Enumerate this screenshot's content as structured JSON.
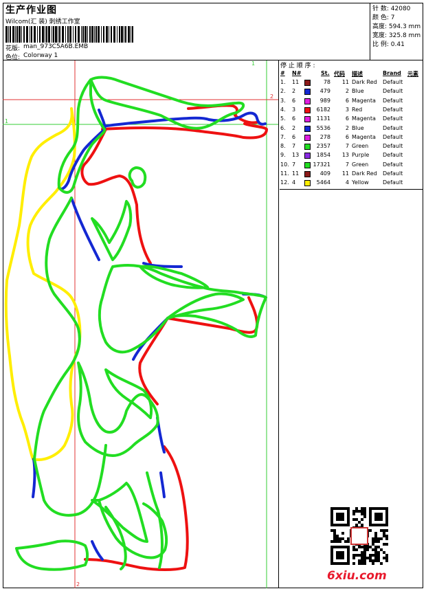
{
  "header": {
    "title": "生产作业图",
    "studio": "Wilcom(汇 装) 刺绣工作室",
    "design_label": "花版:",
    "design_file": "man_973C5A6B.EMB",
    "colorway_label": "色位:",
    "colorway": "Colorway 1"
  },
  "info": {
    "stitches_label": "针 数:",
    "stitches": "42080",
    "colors_label": "颜 色:",
    "colors": "7",
    "height_label": "高度:",
    "height": "594.3 mm",
    "width_label": "宽度:",
    "width": "325.8 mm",
    "scale_label": "比 例:",
    "scale": "0.41"
  },
  "table": {
    "stop_title": "停 止 顺 序 :",
    "headers": {
      "num": "#",
      "no": "N#",
      "st": "St.",
      "code": "代码",
      "desc": "描述",
      "brand": "Brand",
      "elem": "元素"
    },
    "rows": [
      {
        "idx": "1.",
        "n": "11",
        "color": "#8b1a1a",
        "st": "78",
        "code": "11",
        "desc": "Dark Red",
        "brand": "Default"
      },
      {
        "idx": "2.",
        "n": "2",
        "color": "#1428d2",
        "st": "479",
        "code": "2",
        "desc": "Blue",
        "brand": "Default"
      },
      {
        "idx": "3.",
        "n": "6",
        "color": "#e020e0",
        "st": "989",
        "code": "6",
        "desc": "Magenta",
        "brand": "Default"
      },
      {
        "idx": "4.",
        "n": "3",
        "color": "#ee1111",
        "st": "6182",
        "code": "3",
        "desc": "Red",
        "brand": "Default"
      },
      {
        "idx": "5.",
        "n": "6",
        "color": "#e020e0",
        "st": "1131",
        "code": "6",
        "desc": "Magenta",
        "brand": "Default"
      },
      {
        "idx": "6.",
        "n": "2",
        "color": "#1428d2",
        "st": "5536",
        "code": "2",
        "desc": "Blue",
        "brand": "Default"
      },
      {
        "idx": "7.",
        "n": "6",
        "color": "#e020e0",
        "st": "278",
        "code": "6",
        "desc": "Magenta",
        "brand": "Default"
      },
      {
        "idx": "8.",
        "n": "7",
        "color": "#22dd22",
        "st": "2357",
        "code": "7",
        "desc": "Green",
        "brand": "Default"
      },
      {
        "idx": "9.",
        "n": "13",
        "color": "#8a2be2",
        "st": "1854",
        "code": "13",
        "desc": "Purple",
        "brand": "Default"
      },
      {
        "idx": "10.",
        "n": "7",
        "color": "#22dd22",
        "st": "17321",
        "code": "7",
        "desc": "Green",
        "brand": "Default"
      },
      {
        "idx": "11.",
        "n": "11",
        "color": "#8b1a1a",
        "st": "409",
        "code": "11",
        "desc": "Dark Red",
        "brand": "Default"
      },
      {
        "idx": "12.",
        "n": "4",
        "color": "#ffee00",
        "st": "5464",
        "code": "4",
        "desc": "Yellow",
        "brand": "Default"
      }
    ]
  },
  "guides": {
    "v1": "1",
    "h1": "1",
    "h2": "2",
    "v2": "2"
  },
  "watermark": "6xiu.com",
  "colors": {
    "green": "#22dd22",
    "red": "#ee1111",
    "blue": "#1428d2",
    "yellow": "#ffee00",
    "guide_red": "#e03030",
    "guide_green": "#33cc33"
  }
}
